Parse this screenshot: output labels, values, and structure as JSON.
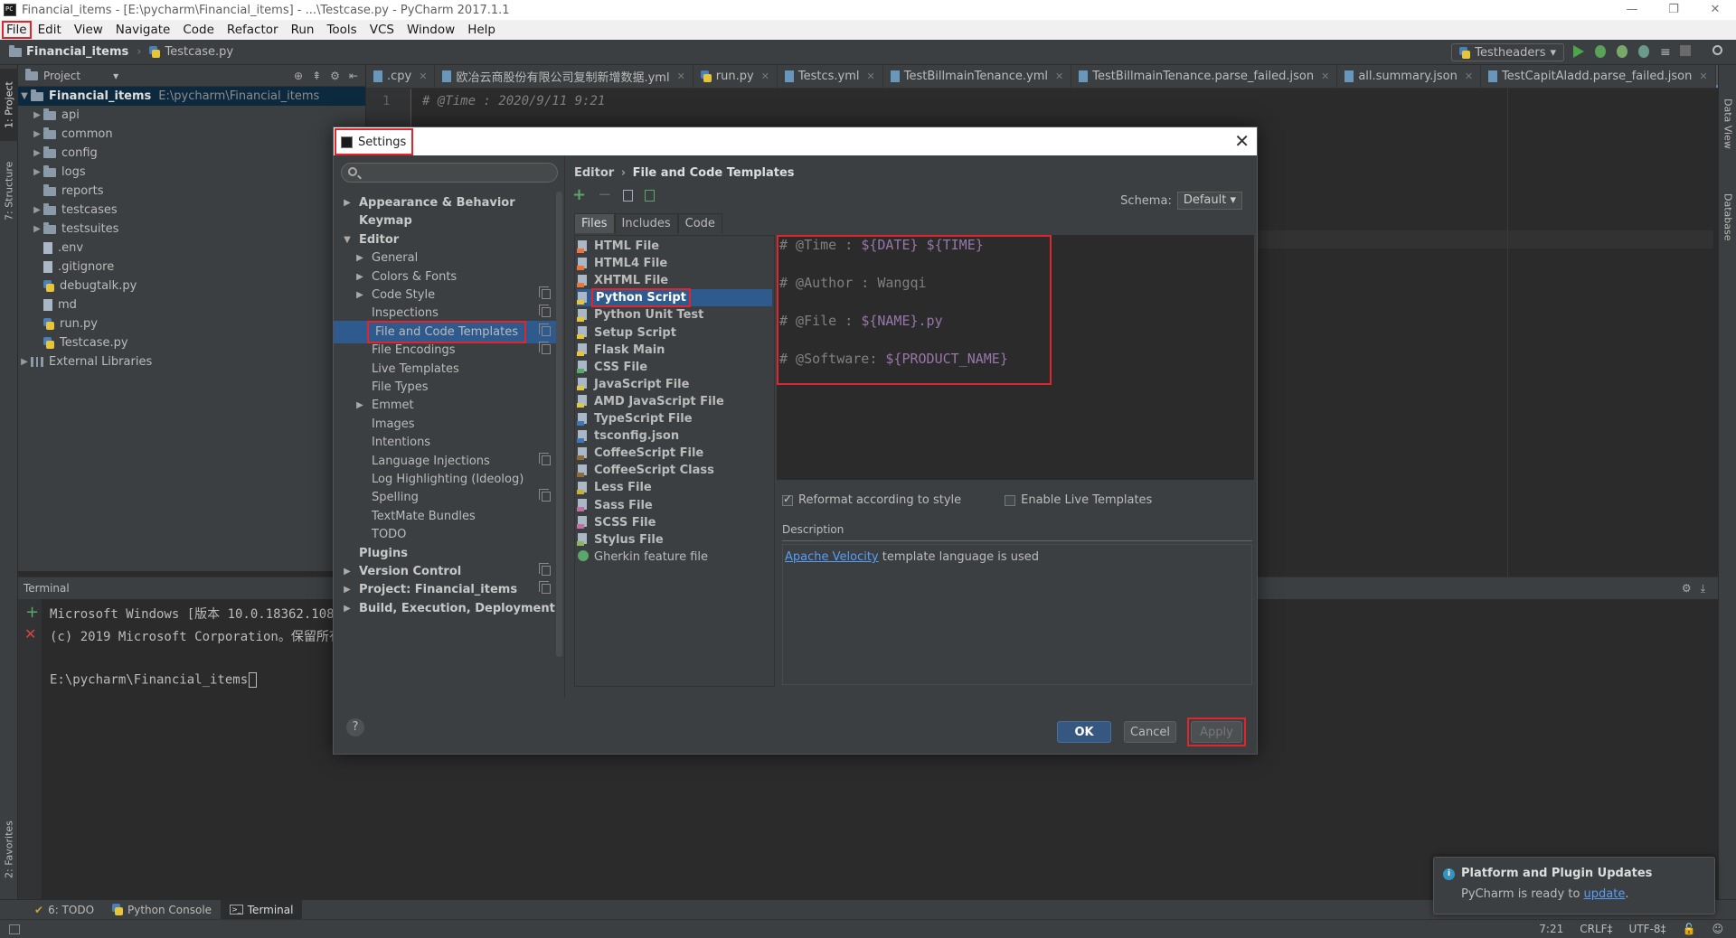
{
  "window": {
    "title": "Financial_items - [E:\\pycharm\\Financial_items] - ...\\Testcase.py - PyCharm 2017.1.1",
    "controls": [
      "—",
      "❐",
      "✕"
    ]
  },
  "menu": [
    "File",
    "Edit",
    "View",
    "Navigate",
    "Code",
    "Refactor",
    "Run",
    "Tools",
    "VCS",
    "Window",
    "Help"
  ],
  "nav": {
    "project": "Financial_items",
    "file": "Testcase.py",
    "run_config": "Testheaders"
  },
  "left_strip": {
    "project_tab": "1: Project",
    "structure_tab": "7: Structure",
    "favorites_tab": "2: Favorites"
  },
  "right_strip": {
    "data_view": "Data View",
    "database": "Database"
  },
  "project_panel": {
    "header": "Project",
    "root_name": "Financial_items",
    "root_path": "E:\\pycharm\\Financial_items",
    "items": [
      {
        "label": "api",
        "type": "folder",
        "expandable": true
      },
      {
        "label": "common",
        "type": "folder",
        "expandable": true
      },
      {
        "label": "config",
        "type": "folder",
        "expandable": true
      },
      {
        "label": "logs",
        "type": "folder",
        "expandable": true
      },
      {
        "label": "reports",
        "type": "folder",
        "expandable": false
      },
      {
        "label": "testcases",
        "type": "folder",
        "expandable": true
      },
      {
        "label": "testsuites",
        "type": "folder",
        "expandable": true
      },
      {
        "label": ".env",
        "type": "file"
      },
      {
        "label": ".gitignore",
        "type": "file"
      },
      {
        "label": "debugtalk.py",
        "type": "python"
      },
      {
        "label": "md",
        "type": "file"
      },
      {
        "label": "run.py",
        "type": "python"
      },
      {
        "label": "Testcase.py",
        "type": "python"
      }
    ],
    "external": "External Libraries"
  },
  "editor_tabs": [
    {
      "label": ".cpy",
      "active": false
    },
    {
      "label": "欧冶云商股份有限公司复制新增数据.yml",
      "active": false
    },
    {
      "label": "run.py",
      "active": false
    },
    {
      "label": "Testcs.yml",
      "active": false
    },
    {
      "label": "TestBillmainTenance.yml",
      "active": false
    },
    {
      "label": "TestBillmainTenance.parse_failed.json",
      "active": false
    },
    {
      "label": "all.summary.json",
      "active": false
    },
    {
      "label": "TestCapitAladd.parse_failed.json",
      "active": false
    },
    {
      "label": "Testcase.py",
      "active": true
    }
  ],
  "tab_overflow": "≡2",
  "editor": {
    "line_number": "1",
    "line_text": "# @Time : 2020/9/11 9:21"
  },
  "terminal": {
    "title": "Terminal",
    "lines": [
      "Microsoft Windows [版本 10.0.18362.1082",
      "(c) 2019 Microsoft Corporation。保留所有",
      "",
      "E:\\pycharm\\Financial_items"
    ]
  },
  "bottom_tabs": [
    {
      "label": "6: TODO",
      "active": false
    },
    {
      "label": "Python Console",
      "active": false
    },
    {
      "label": "Terminal",
      "active": true
    }
  ],
  "status": {
    "position": "7:21",
    "line_sep": "CRLF‡",
    "encoding": "UTF-8‡"
  },
  "settings": {
    "title": "Settings",
    "search_placeholder": "",
    "tree": [
      {
        "label": "Appearance & Behavior",
        "level": 0,
        "arrow": "right",
        "bold": true
      },
      {
        "label": "Keymap",
        "level": 0,
        "arrow": "",
        "bold": true
      },
      {
        "label": "Editor",
        "level": 0,
        "arrow": "down",
        "bold": true
      },
      {
        "label": "General",
        "level": 1,
        "arrow": "right"
      },
      {
        "label": "Colors & Fonts",
        "level": 1,
        "arrow": "right"
      },
      {
        "label": "Code Style",
        "level": 1,
        "arrow": "right",
        "copy": true
      },
      {
        "label": "Inspections",
        "level": 1,
        "arrow": "",
        "copy": true
      },
      {
        "label": "File and Code Templates",
        "level": 1,
        "arrow": "",
        "copy": true,
        "selected": true
      },
      {
        "label": "File Encodings",
        "level": 1,
        "arrow": "",
        "copy": true
      },
      {
        "label": "Live Templates",
        "level": 1,
        "arrow": ""
      },
      {
        "label": "File Types",
        "level": 1,
        "arrow": ""
      },
      {
        "label": "Emmet",
        "level": 1,
        "arrow": "right"
      },
      {
        "label": "Images",
        "level": 1,
        "arrow": ""
      },
      {
        "label": "Intentions",
        "level": 1,
        "arrow": ""
      },
      {
        "label": "Language Injections",
        "level": 1,
        "arrow": "",
        "copy": true
      },
      {
        "label": "Log Highlighting (Ideolog)",
        "level": 1,
        "arrow": ""
      },
      {
        "label": "Spelling",
        "level": 1,
        "arrow": "",
        "copy": true
      },
      {
        "label": "TextMate Bundles",
        "level": 1,
        "arrow": ""
      },
      {
        "label": "TODO",
        "level": 1,
        "arrow": ""
      },
      {
        "label": "Plugins",
        "level": 0,
        "arrow": "",
        "bold": true
      },
      {
        "label": "Version Control",
        "level": 0,
        "arrow": "right",
        "bold": true,
        "copy": true
      },
      {
        "label": "Project: Financial_items",
        "level": 0,
        "arrow": "right",
        "bold": true,
        "copy": true
      },
      {
        "label": "Build, Execution, Deployment",
        "level": 0,
        "arrow": "right",
        "bold": true
      }
    ],
    "breadcrumb_first": "Editor",
    "breadcrumb_sep": "›",
    "breadcrumb_second": "File and Code Templates",
    "schema_label": "Schema:",
    "schema_value": "Default",
    "template_tabs": [
      {
        "label": "Files",
        "active": true
      },
      {
        "label": "Includes",
        "active": false
      },
      {
        "label": "Code",
        "active": false
      }
    ],
    "templates": [
      {
        "label": "HTML File",
        "color": "#e8753a"
      },
      {
        "label": "HTML4 File",
        "color": "#e8753a"
      },
      {
        "label": "XHTML File",
        "color": "#e8753a"
      },
      {
        "label": "Python Script",
        "color": "#e6c53a",
        "selected": true
      },
      {
        "label": "Python Unit Test",
        "color": "#e6c53a"
      },
      {
        "label": "Setup Script",
        "color": "#e6c53a"
      },
      {
        "label": "Flask Main",
        "color": "#e6c53a"
      },
      {
        "label": "CSS File",
        "color": "#59a869"
      },
      {
        "label": "JavaScript File",
        "color": "#d9c94a"
      },
      {
        "label": "AMD JavaScript File",
        "color": "#d9c94a"
      },
      {
        "label": "TypeScript File",
        "color": "#3d78b5"
      },
      {
        "label": "tsconfig.json",
        "color": "#3d78b5"
      },
      {
        "label": "CoffeeScript File",
        "color": "#8a6d3b"
      },
      {
        "label": "CoffeeScript Class",
        "color": "#8a6d3b"
      },
      {
        "label": "Less File",
        "color": "#c5b03a"
      },
      {
        "label": "Sass File",
        "color": "#c06fa0"
      },
      {
        "label": "SCSS File",
        "color": "#c06fa0"
      },
      {
        "label": "Stylus File",
        "color": "#8fb35c"
      },
      {
        "label": "Gherkin feature file",
        "color": "#59a869",
        "plain": true,
        "circle": true
      }
    ],
    "template_lines": [
      {
        "comment": "# @Time : ",
        "var": "${DATE} ${TIME}"
      },
      {
        "comment": "# @Author : Wangqi",
        "var": ""
      },
      {
        "comment": "# @File : ",
        "var": "${NAME}.py"
      },
      {
        "comment": "# @Software: ",
        "var": "${PRODUCT_NAME}"
      }
    ],
    "reformat_label": "Reformat according to style",
    "reformat_checked": true,
    "live_label": "Enable Live Templates",
    "live_checked": false,
    "description_label": "Description",
    "description_link": "Apache Velocity",
    "description_text": " template language is used",
    "help": "?",
    "ok": "OK",
    "cancel": "Cancel",
    "apply": "Apply",
    "close": "✕"
  },
  "notification": {
    "title": "Platform and Plugin Updates",
    "body_prefix": "PyCharm is ready to ",
    "link": "update",
    "body_suffix": "."
  },
  "colors": {
    "highlight_red": "#e0252c",
    "selection_blue": "#2f5a8d",
    "link": "#589df6",
    "velocity_var": "#9876aa"
  }
}
